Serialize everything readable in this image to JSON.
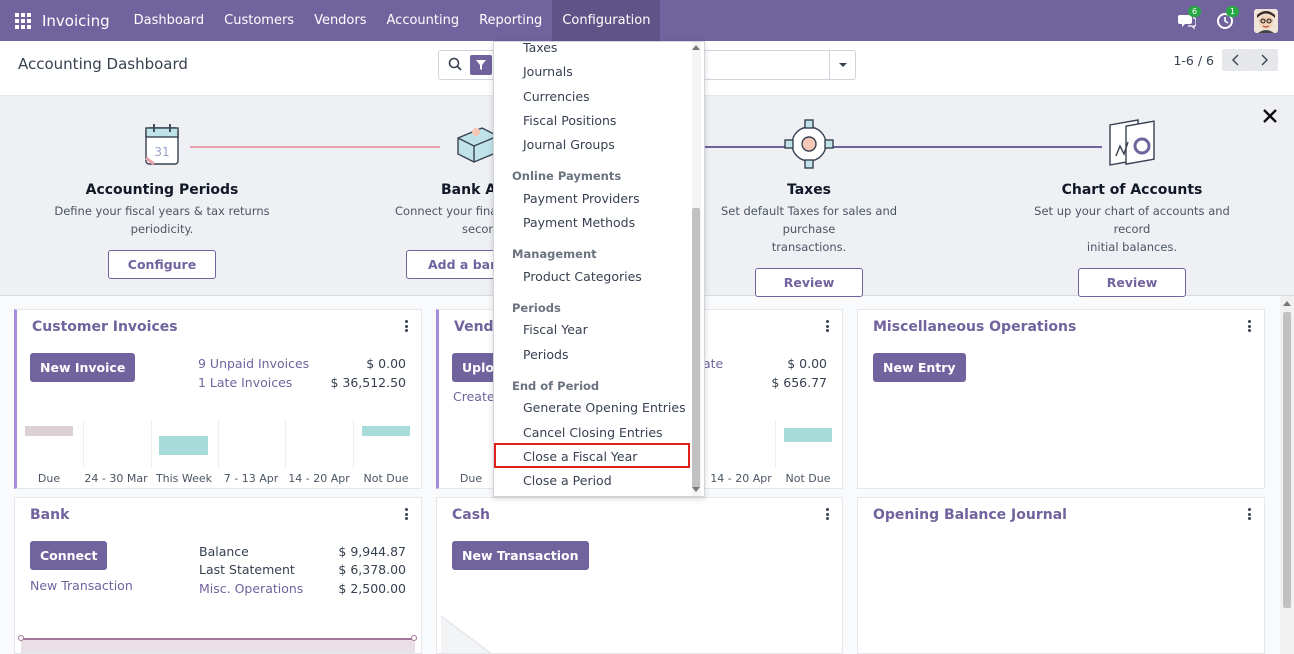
{
  "navbar": {
    "brand": "Invoicing",
    "items": [
      "Dashboard",
      "Customers",
      "Vendors",
      "Accounting",
      "Reporting",
      "Configuration"
    ],
    "messages_badge": "6",
    "activities_badge": "1",
    "color": "#71639e"
  },
  "control": {
    "title": "Accounting Dashboard",
    "pager": "1-6 / 6"
  },
  "onboarding": {
    "steps": [
      {
        "title": "Accounting Periods",
        "desc1": "Define your fiscal years & tax returns",
        "desc2": "periodicity.",
        "button": "Configure"
      },
      {
        "title": "Bank Ac",
        "desc1": "Connect your finar",
        "desc2": "secon",
        "button": "Add a bank"
      },
      {
        "title": "Taxes",
        "desc1": "Set default Taxes for sales and purchase",
        "desc2": "transactions.",
        "button": "Review"
      },
      {
        "title": "Chart of Accounts",
        "desc1": "Set up your chart of accounts and record",
        "desc2": "initial balances.",
        "button": "Review"
      }
    ]
  },
  "cards": {
    "customer_invoices": {
      "title": "Customer Invoices",
      "button": "New Invoice",
      "unpaid_link": "9 Unpaid Invoices",
      "unpaid_value": "$ 0.00",
      "late_link": "1 Late Invoices",
      "late_value": "$ 36,512.50",
      "graph_labels": [
        "Due",
        "24 - 30 Mar",
        "This Week",
        "7 - 13 Apr",
        "14 - 20 Apr",
        "Not Due"
      ]
    },
    "vendor_bills": {
      "title": "Vendo",
      "button": "Uploa",
      "create_link": "Create",
      "link1_tail": "ate",
      "value1": "$ 0.00",
      "value2": "$ 656.77",
      "graph_labels": [
        "Due",
        "14 - 20 Apr",
        "Not Due"
      ]
    },
    "misc": {
      "title": "Miscellaneous Operations",
      "button": "New Entry"
    },
    "bank": {
      "title": "Bank",
      "button": "Connect",
      "new_transaction": "New Transaction",
      "balance_label": "Balance",
      "balance_value": "$ 9,944.87",
      "last_statement_label": "Last Statement",
      "last_statement_value": "$ 6,378.00",
      "misc_link": "Misc. Operations",
      "misc_value": "$ 2,500.00"
    },
    "cash": {
      "title": "Cash",
      "button": "New Transaction"
    },
    "opening": {
      "title": "Opening Balance Journal"
    }
  },
  "dropdown": {
    "items_top": [
      "Taxes",
      "Journals",
      "Currencies",
      "Fiscal Positions",
      "Journal Groups"
    ],
    "online_payments_header": "Online Payments",
    "online_payments": [
      "Payment Providers",
      "Payment Methods"
    ],
    "management_header": "Management",
    "management": [
      "Product Categories"
    ],
    "periods_header": "Periods",
    "periods": [
      "Fiscal Year",
      "Periods"
    ],
    "end_header": "End of Period",
    "end": [
      "Generate Opening Entries",
      "Cancel Closing Entries",
      "Close a Fiscal Year",
      "Close a Period"
    ]
  }
}
